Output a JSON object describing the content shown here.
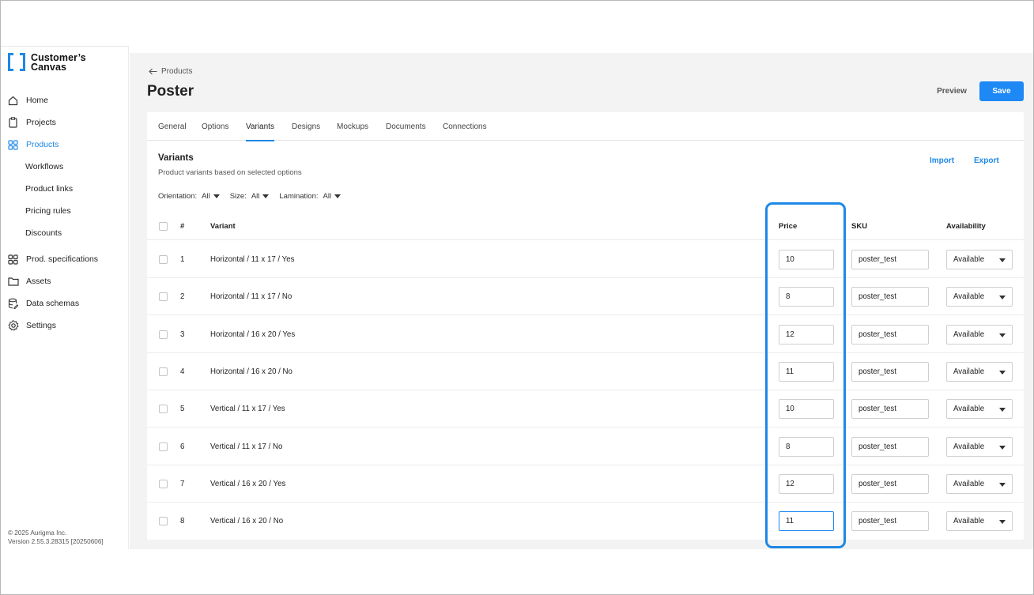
{
  "brand": {
    "line1": "Customer’s",
    "line2": "Canvas"
  },
  "nav": [
    {
      "label": "Home",
      "icon": "home-icon"
    },
    {
      "label": "Projects",
      "icon": "clipboard-icon"
    },
    {
      "label": "Products",
      "icon": "grid-icon",
      "active": true
    },
    {
      "label": "Workflows"
    },
    {
      "label": "Product links"
    },
    {
      "label": "Pricing rules"
    },
    {
      "label": "Discounts"
    },
    {
      "label": "Prod. specifications",
      "icon": "grid-icon"
    },
    {
      "label": "Assets",
      "icon": "folder-icon"
    },
    {
      "label": "Data schemas",
      "icon": "database-icon"
    },
    {
      "label": "Settings",
      "icon": "gear-icon"
    }
  ],
  "footer": {
    "copyright": "© 2025 Aurigma Inc.",
    "version": "Version 2.55.3.28315 [20250606]"
  },
  "header": {
    "back_label": "Products",
    "title": "Poster",
    "preview_label": "Preview",
    "save_label": "Save"
  },
  "tabs": [
    "General",
    "Options",
    "Variants",
    "Designs",
    "Mockups",
    "Documents",
    "Connections"
  ],
  "active_tab": "Variants",
  "section": {
    "title": "Variants",
    "subtitle": "Product variants based on selected options",
    "import_label": "Import",
    "export_label": "Export"
  },
  "filters": [
    {
      "label": "Orientation:",
      "value": "All"
    },
    {
      "label": "Size:",
      "value": "All"
    },
    {
      "label": "Lamination:",
      "value": "All"
    }
  ],
  "table": {
    "headers": {
      "num": "#",
      "variant": "Variant",
      "price": "Price",
      "sku": "SKU",
      "availability": "Availability"
    },
    "rows": [
      {
        "num": "1",
        "variant": "Horizontal / 11 x 17 / Yes",
        "price": "10",
        "sku": "poster_test",
        "availability": "Available"
      },
      {
        "num": "2",
        "variant": "Horizontal / 11 x 17 / No",
        "price": "8",
        "sku": "poster_test",
        "availability": "Available"
      },
      {
        "num": "3",
        "variant": "Horizontal / 16 x 20 / Yes",
        "price": "12",
        "sku": "poster_test",
        "availability": "Available"
      },
      {
        "num": "4",
        "variant": "Horizontal / 16 x 20 / No",
        "price": "11",
        "sku": "poster_test",
        "availability": "Available"
      },
      {
        "num": "5",
        "variant": "Vertical / 11 x 17 / Yes",
        "price": "10",
        "sku": "poster_test",
        "availability": "Available"
      },
      {
        "num": "6",
        "variant": "Vertical / 11 x 17 / No",
        "price": "8",
        "sku": "poster_test",
        "availability": "Available"
      },
      {
        "num": "7",
        "variant": "Vertical / 16 x 20 / Yes",
        "price": "12",
        "sku": "poster_test",
        "availability": "Available"
      },
      {
        "num": "8",
        "variant": "Vertical / 16 x 20 / No",
        "price": "11",
        "sku": "poster_test",
        "availability": "Available"
      }
    ]
  },
  "colors": {
    "accent": "#1e88e5",
    "save_button": "#1e88f5",
    "background": "#f3f3f3"
  }
}
